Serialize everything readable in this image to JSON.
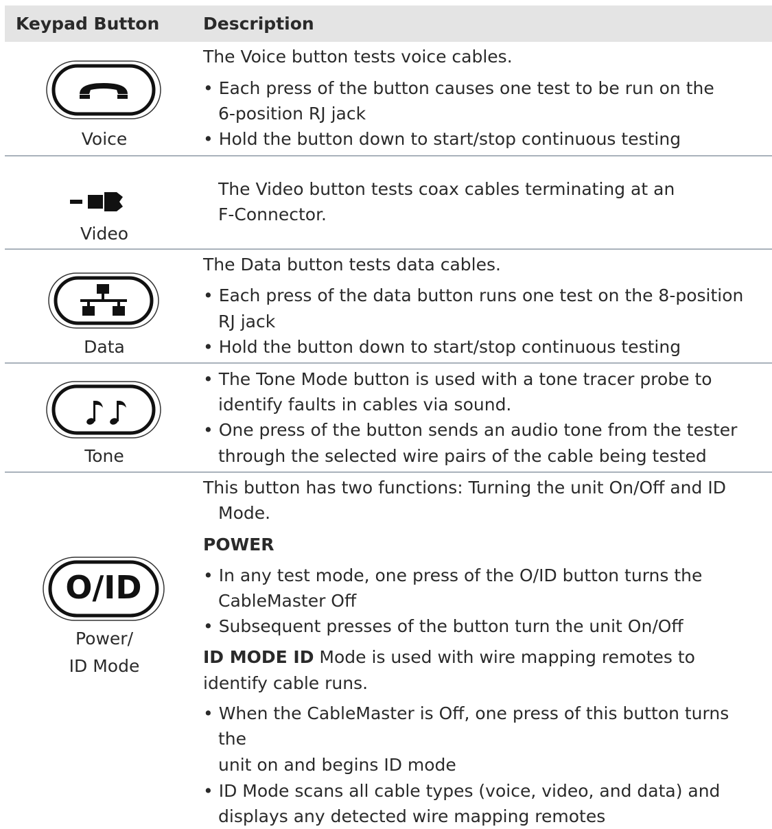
{
  "header": {
    "col1": "Keypad Button",
    "col2": "Description"
  },
  "rows": {
    "voice": {
      "label": "Voice",
      "lines": [
        "The Voice button tests voice cables.",
        "• Each press of the button causes one test to be run on the",
        "6-position RJ jack",
        "• Hold the button down to start/stop continuous testing"
      ]
    },
    "video": {
      "label": "Video",
      "lines": [
        "The Video button tests coax cables terminating at an",
        "F-Connector."
      ]
    },
    "data": {
      "label": "Data",
      "lines": [
        "The Data button tests data cables.",
        "• Each press of the data button runs one test on the 8-position",
        "RJ jack",
        "• Hold the button down to start/stop continuous testing"
      ]
    },
    "tone": {
      "label": "Tone",
      "lines": [
        "• The Tone Mode button is used with a tone tracer probe to",
        "identify faults in cables via sound.",
        "• One press of the button sends an audio tone from the tester",
        "through the selected wire pairs of the cable being tested"
      ]
    },
    "power": {
      "label_line1": "Power/",
      "label_line2": "ID Mode",
      "button_text": "O/ID",
      "lines": [
        "This button has two functions: Turning the unit On/Off and ID",
        "Mode.",
        "POWER",
        "• In any test mode, one press of the O/ID button turns the",
        "CableMaster Off",
        "• Subsequent presses of the button turn the unit On/Off",
        "ID MODE ID",
        " Mode is used with wire mapping remotes to",
        "identify cable runs.",
        "• When the CableMaster is Off, one press of this button turns",
        "the",
        "unit on and begins ID mode",
        "• ID Mode scans all cable types (voice, video, and data) and",
        "displays any detected wire mapping remotes"
      ]
    }
  },
  "icons": {
    "voice": "phone-handset-icon",
    "video": "coax-connector-icon",
    "data": "network-topology-icon",
    "tone": "music-notes-icon",
    "power": "oid-button-icon"
  }
}
